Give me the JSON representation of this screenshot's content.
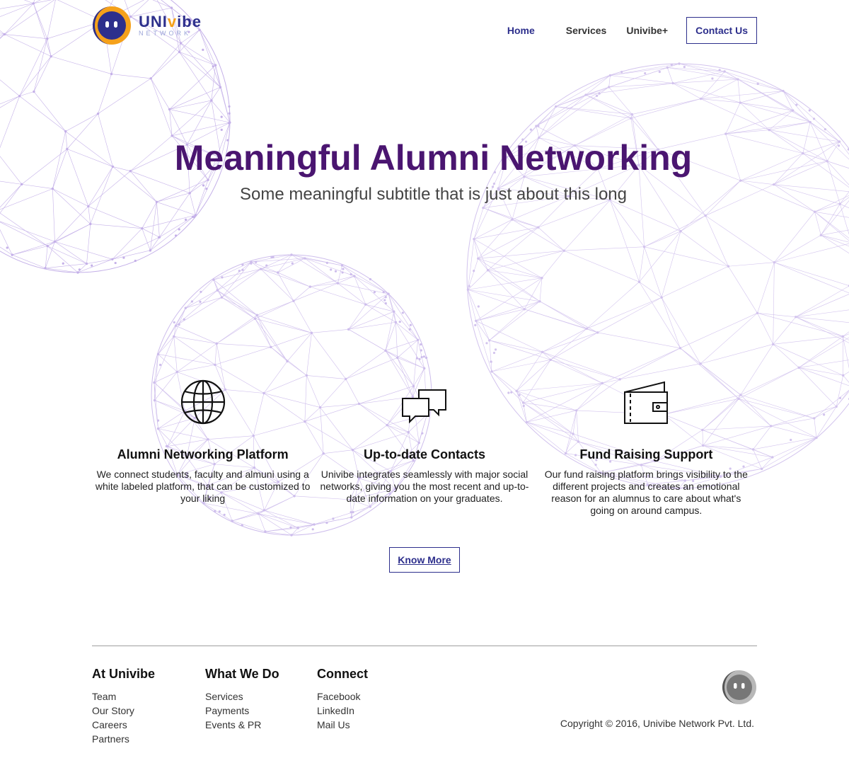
{
  "brand": {
    "name_prefix": "UNI",
    "name_accent": "v",
    "name_suffix": "ibe",
    "tagline": "NETWORK",
    "colors": {
      "primary": "#2d2f8c",
      "accent": "#f5a11a",
      "heading": "#4a1570",
      "network": "#8a63d2"
    }
  },
  "nav": {
    "home": "Home",
    "services": "Services",
    "univibe_plus": "Univibe+",
    "contact": "Contact Us"
  },
  "hero": {
    "title": "Meaningful Alumni Networking",
    "subtitle": "Some meaningful subtitle that is just about this long"
  },
  "features": [
    {
      "icon": "globe-icon",
      "title": "Alumni Networking Platform",
      "text": "We connect students, faculty and almuni using a white labeled platform, that can be customized to your liking"
    },
    {
      "icon": "chat-bubbles-icon",
      "title": "Up-to-date Contacts",
      "text": "Univibe integrates seamlessly with major social networks, giving you the most recent and up-to-date information on your graduates."
    },
    {
      "icon": "wallet-icon",
      "title": "Fund Raising Support",
      "text": "Our fund raising platform brings visibility to the different projects and creates an emotional reason for an alumnus to care about what's going on around campus."
    }
  ],
  "cta": {
    "know_more": "Know More"
  },
  "footer": {
    "col1": {
      "heading": "At Univibe",
      "links": [
        "Team",
        "Our Story",
        "Careers",
        "Partners"
      ]
    },
    "col2": {
      "heading": "What We Do",
      "links": [
        "Services",
        "Payments",
        "Events & PR"
      ]
    },
    "col3": {
      "heading": "Connect",
      "links": [
        "Facebook",
        "LinkedIn",
        "Mail Us"
      ]
    },
    "copyright": "Copyright © 2016, Univibe Network Pvt. Ltd."
  }
}
